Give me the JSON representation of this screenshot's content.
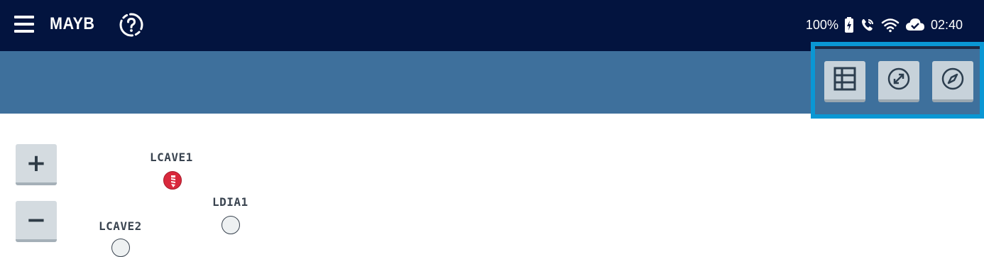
{
  "header": {
    "app_title": "MAYB",
    "menu_icon": "hamburger-menu-icon",
    "help_icon": "help-question-icon"
  },
  "status_bar": {
    "battery": "100%",
    "time": "02:40",
    "icons": [
      "battery-charging-icon",
      "phone-call-icon",
      "wifi-icon",
      "cloud-check-icon"
    ]
  },
  "toolbar": {
    "buttons": [
      {
        "icon": "grid-table-icon"
      },
      {
        "icon": "expand-circle-icon"
      },
      {
        "icon": "compass-icon"
      }
    ]
  },
  "zoom": {
    "in_label": "+",
    "out_label": "−"
  },
  "map_nodes": [
    {
      "label": "LCAVE1",
      "state": "active",
      "color": "#d9283c"
    },
    {
      "label": "LDIA1",
      "state": "inactive",
      "color": "#eef1f2"
    },
    {
      "label": "LCAVE2",
      "state": "inactive",
      "color": "#eef1f2"
    }
  ],
  "colors": {
    "topbar": "#03143f",
    "subbar": "#3e709c",
    "toolbox_border": "#0a97d4",
    "active_node": "#d9283c"
  }
}
